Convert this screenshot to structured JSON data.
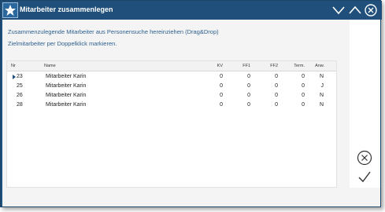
{
  "window": {
    "title": "Mitarbeiter zusammenlegen"
  },
  "hints": {
    "line1": "Zusammenzulegende Mitarbeiter aus Personensuche hereinziehen (Drag&Drop)",
    "line2": "Zielmitarbeiter per Doppelklick markieren."
  },
  "table": {
    "columns": [
      "Nr",
      "Name",
      "KV",
      "FF1",
      "FF2",
      "Term.",
      "Anw."
    ],
    "rows": [
      {
        "nr": "23",
        "name": "Mitarbeiter Karin",
        "kv": "0",
        "ff1": "0",
        "ff2": "0",
        "term": "0",
        "anw": "N",
        "current": true
      },
      {
        "nr": "25",
        "name": "Mitarbeiter Karin",
        "kv": "0",
        "ff1": "0",
        "ff2": "0",
        "term": "0",
        "anw": "J",
        "current": false
      },
      {
        "nr": "26",
        "name": "Mitarbeiter Karin",
        "kv": "0",
        "ff1": "0",
        "ff2": "0",
        "term": "0",
        "anw": "N",
        "current": false
      },
      {
        "nr": "28",
        "name": "Mitarbeiter Karin",
        "kv": "0",
        "ff1": "0",
        "ff2": "0",
        "term": "0",
        "anw": "N",
        "current": false
      }
    ]
  },
  "icons": {
    "app": "star-icon",
    "minimize": "chevron-down-icon",
    "maximize": "chevron-up-icon",
    "close": "close-icon",
    "cancel": "cancel-circle-icon",
    "confirm": "checkmark-icon"
  },
  "colors": {
    "titlebar": "#1f4f7a",
    "hint_text": "#2d5f8e"
  }
}
